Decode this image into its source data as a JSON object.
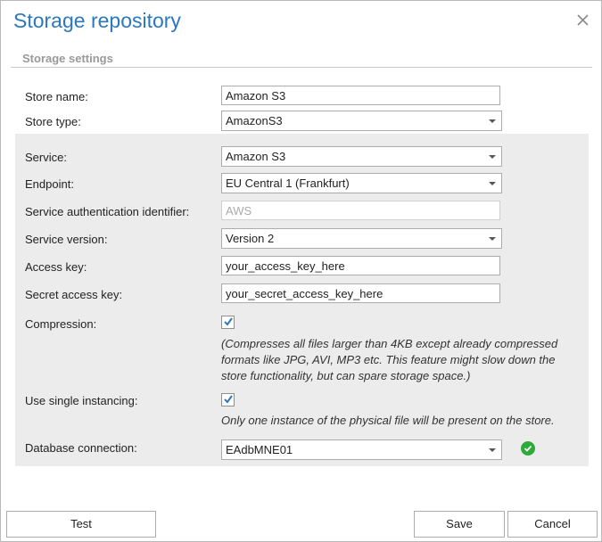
{
  "dialog": {
    "title": "Storage repository",
    "close_icon": "close-icon",
    "section_title": "Storage settings"
  },
  "fields": {
    "store_name": {
      "label": "Store name:",
      "value": "Amazon S3"
    },
    "store_type": {
      "label": "Store type:",
      "value": "AmazonS3"
    },
    "service": {
      "label": "Service:",
      "value": "Amazon S3"
    },
    "endpoint": {
      "label": "Endpoint:",
      "value": "EU Central 1 (Frankfurt)"
    },
    "service_auth_id": {
      "label": "Service authentication identifier:",
      "value": "AWS"
    },
    "service_version": {
      "label": "Service version:",
      "value": "Version 2"
    },
    "access_key": {
      "label": "Access key:",
      "value": "your_access_key_here"
    },
    "secret_access_key": {
      "label": "Secret access key:",
      "value": "your_secret_access_key_here"
    },
    "compression": {
      "label": "Compression:",
      "checked": true,
      "note_lines": [
        "(Compresses all files larger than 4KB except already compressed",
        "formats like JPG, AVI, MP3 etc. This feature might slow down the",
        "store functionality, but can spare storage space.)"
      ]
    },
    "single_instancing": {
      "label": "Use single instancing:",
      "checked": true,
      "note": "Only one instance of the physical file will be present on the store."
    },
    "database_connection": {
      "label": "Database connection:",
      "value": "EAdbMNE01",
      "status_icon": "check-circle-icon"
    }
  },
  "buttons": {
    "test": "Test",
    "save": "Save",
    "cancel": "Cancel"
  },
  "colors": {
    "title": "#2c77bd",
    "panel_bg": "#ececec",
    "status_ok": "#2eaa3a"
  }
}
